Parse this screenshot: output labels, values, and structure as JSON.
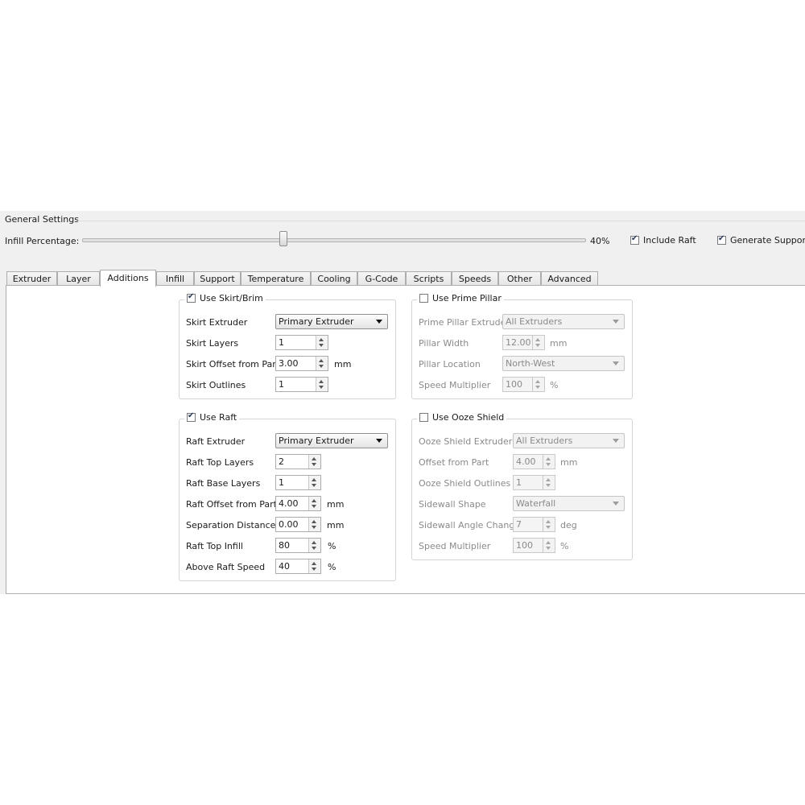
{
  "general": {
    "title": "General Settings",
    "infill_label": "Infill Percentage:",
    "infill_value": 0.4,
    "infill_display": "40%",
    "include_raft": {
      "label": "Include Raft",
      "checked": true
    },
    "generate_support": {
      "label": "Generate Support",
      "checked": true
    }
  },
  "tabs": [
    {
      "label": "Extruder"
    },
    {
      "label": "Layer"
    },
    {
      "label": "Additions",
      "active": true
    },
    {
      "label": "Infill"
    },
    {
      "label": "Support"
    },
    {
      "label": "Temperature"
    },
    {
      "label": "Cooling"
    },
    {
      "label": "G-Code"
    },
    {
      "label": "Scripts"
    },
    {
      "label": "Speeds"
    },
    {
      "label": "Other"
    },
    {
      "label": "Advanced"
    }
  ],
  "skirt": {
    "title": "Use Skirt/Brim",
    "checked": true,
    "extruder_label": "Skirt Extruder",
    "extruder_value": "Primary Extruder",
    "layers_label": "Skirt Layers",
    "layers_value": "1",
    "offset_label": "Skirt Offset from Part",
    "offset_value": "3.00",
    "offset_unit": "mm",
    "outlines_label": "Skirt Outlines",
    "outlines_value": "1"
  },
  "raft": {
    "title": "Use Raft",
    "checked": true,
    "extruder_label": "Raft Extruder",
    "extruder_value": "Primary Extruder",
    "top_layers_label": "Raft Top Layers",
    "top_layers_value": "2",
    "base_layers_label": "Raft Base Layers",
    "base_layers_value": "1",
    "offset_label": "Raft Offset from Part",
    "offset_value": "4.00",
    "offset_unit": "mm",
    "separation_label": "Separation Distance",
    "separation_value": "0.00",
    "separation_unit": "mm",
    "top_infill_label": "Raft Top Infill",
    "top_infill_value": "80",
    "top_infill_unit": "%",
    "above_speed_label": "Above Raft Speed",
    "above_speed_value": "40",
    "above_speed_unit": "%"
  },
  "pillar": {
    "title": "Use Prime Pillar",
    "checked": false,
    "extruder_label": "Prime Pillar Extruder",
    "extruder_value": "All Extruders",
    "width_label": "Pillar Width",
    "width_value": "12.00",
    "width_unit": "mm",
    "location_label": "Pillar Location",
    "location_value": "North-West",
    "speed_label": "Speed Multiplier",
    "speed_value": "100",
    "speed_unit": "%"
  },
  "ooze": {
    "title": "Use Ooze Shield",
    "checked": false,
    "extruder_label": "Ooze Shield Extruder",
    "extruder_value": "All Extruders",
    "offset_label": "Offset from Part",
    "offset_value": "4.00",
    "offset_unit": "mm",
    "outlines_label": "Ooze Shield Outlines",
    "outlines_value": "1",
    "sidewall_shape_label": "Sidewall Shape",
    "sidewall_shape_value": "Waterfall",
    "sidewall_angle_label": "Sidewall Angle Change",
    "sidewall_angle_value": "7",
    "sidewall_angle_unit": "deg",
    "speed_label": "Speed Multiplier",
    "speed_value": "100",
    "speed_unit": "%"
  }
}
